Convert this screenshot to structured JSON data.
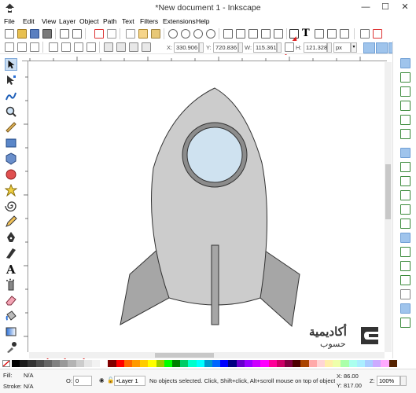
{
  "window": {
    "title": "*New document 1 - Inkscape",
    "minimize": "—",
    "maximize": "☐",
    "close": "✕"
  },
  "menu": [
    "File",
    "Edit",
    "View",
    "Layer",
    "Object",
    "Path",
    "Text",
    "Filters",
    "Extensions",
    "Help"
  ],
  "toolbar2": {
    "x_label": "X:",
    "x_value": "330.906",
    "y_label": "Y:",
    "y_value": "720.836",
    "w_label": "W:",
    "w_value": "115.361",
    "h_label": "H:",
    "h_value": "121.328",
    "unit": "px"
  },
  "palette_colors": [
    "#000000",
    "#1a1a1a",
    "#333333",
    "#4d4d4d",
    "#666666",
    "#808080",
    "#999999",
    "#b3b3b3",
    "#cccccc",
    "#e6e6e6",
    "#f2f2f2",
    "#ffffff",
    "#800000",
    "#ff0000",
    "#ff6600",
    "#ff9900",
    "#ffcc00",
    "#ffff00",
    "#99cc00",
    "#00ff00",
    "#008000",
    "#00cc66",
    "#00ffcc",
    "#00ffff",
    "#0099cc",
    "#0066ff",
    "#0000ff",
    "#000080",
    "#6600cc",
    "#9900ff",
    "#cc00ff",
    "#ff00ff",
    "#ff0099",
    "#cc0066",
    "#800040",
    "#4d0000",
    "#aa4400",
    "#ffaaaa",
    "#ffd5d5",
    "#ffeeaa",
    "#eeffaa",
    "#aaffaa",
    "#aaffee",
    "#aaeeff",
    "#aaccff",
    "#ccaaff",
    "#ffaaff",
    "#552200"
  ],
  "status": {
    "fill_label": "Fill:",
    "fill_value": "N/A",
    "stroke_label": "Stroke:",
    "stroke_value": "N/A",
    "opacity_label": "O:",
    "opacity_value": "0",
    "layer": "•Layer 1",
    "message": "No objects selected. Click, Shift+click, Alt+scroll mouse on top of objects",
    "x_label": "X:",
    "x_value": "86.00",
    "y_label": "Y:",
    "y_value": "817.00",
    "zoom_label": "Z:",
    "zoom_value": "100%"
  },
  "watermark": {
    "line1": "أكاديمية",
    "line2": "حسوب"
  },
  "icons": {
    "app": "inkscape-logo-icon"
  }
}
